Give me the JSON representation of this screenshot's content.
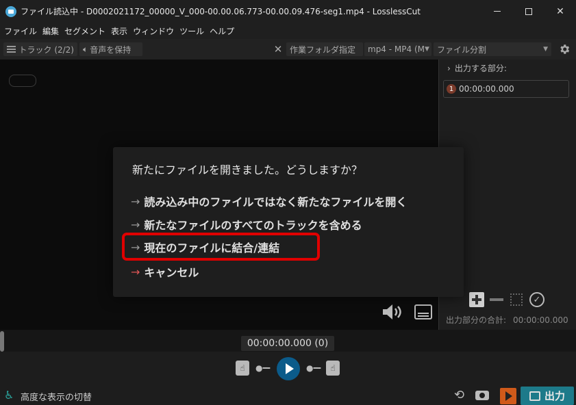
{
  "window": {
    "title": "ファイル読込中 - D0002021172_00000_V_000-00.00.06.773-00.00.09.476-seg1.mp4 - LosslessCut"
  },
  "menu": [
    "ファイル",
    "編集",
    "セグメント",
    "表示",
    "ウィンドウ",
    "ツール",
    "ヘルプ"
  ],
  "toolbar": {
    "tracks_label": "トラック (2/2)",
    "keep_audio_label": "音声を保持",
    "work_folder_label": "作業フォルダ指定",
    "format_value": "mp4 - MP4 (M",
    "export_mode_value": "ファイル分割"
  },
  "right_panel": {
    "title": "出力する部分:",
    "segment": {
      "number": "1",
      "time": "00:00:00.000"
    },
    "total_label": "出力部分の合計:",
    "total_value": "00:00:00.000"
  },
  "dialog": {
    "title": "新たにファイルを開きました。どうしますか？",
    "options": [
      "読み込み中のファイルではなく新たなファイルを開く",
      "新たなファイルのすべてのトラックを含める",
      "現在のファイルに結合/連結",
      "キャンセル"
    ]
  },
  "timeline": {
    "time_display": "00:00:00.000 (0)"
  },
  "status": {
    "advanced_view_label": "高度な表示の切替",
    "export_label": "出力"
  },
  "colors": {
    "accent": "#1d7a8a",
    "highlight": "#e00000",
    "cancel_arrow": "#e05656",
    "play_button": "#0b5b8a"
  }
}
